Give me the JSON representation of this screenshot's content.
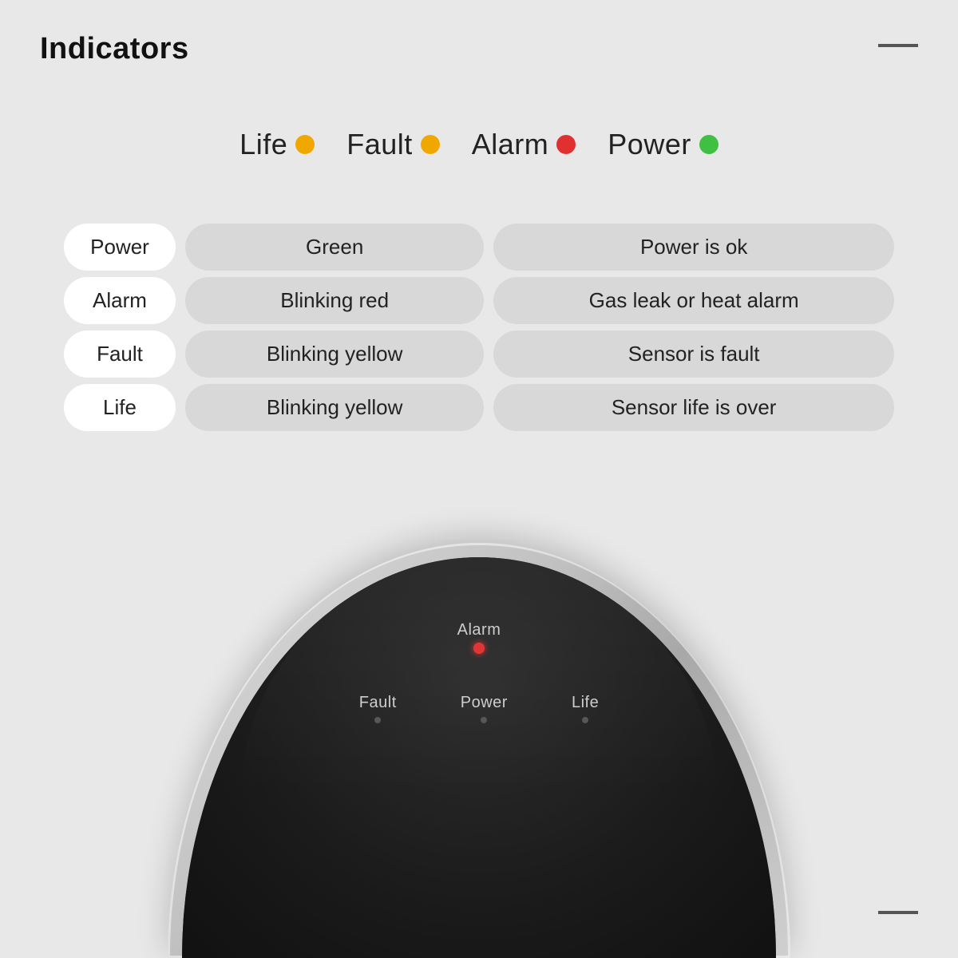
{
  "title": "Indicators",
  "legend": [
    {
      "label": "Life",
      "dotClass": "dot-yellow"
    },
    {
      "label": "Fault",
      "dotClass": "dot-yellow2"
    },
    {
      "label": "Alarm",
      "dotClass": "dot-red"
    },
    {
      "label": "Power",
      "dotClass": "dot-green"
    }
  ],
  "table": {
    "rows": [
      {
        "label": "Power",
        "indicator": "Green",
        "description": "Power is ok"
      },
      {
        "label": "Alarm",
        "indicator": "Blinking red",
        "description": "Gas leak or heat alarm"
      },
      {
        "label": "Fault",
        "indicator": "Blinking yellow",
        "description": "Sensor is fault"
      },
      {
        "label": "Life",
        "indicator": "Blinking yellow",
        "description": "Sensor life is over"
      }
    ]
  },
  "device": {
    "alarm_label": "Alarm",
    "fault_label": "Fault",
    "power_label": "Power",
    "life_label": "Life"
  }
}
